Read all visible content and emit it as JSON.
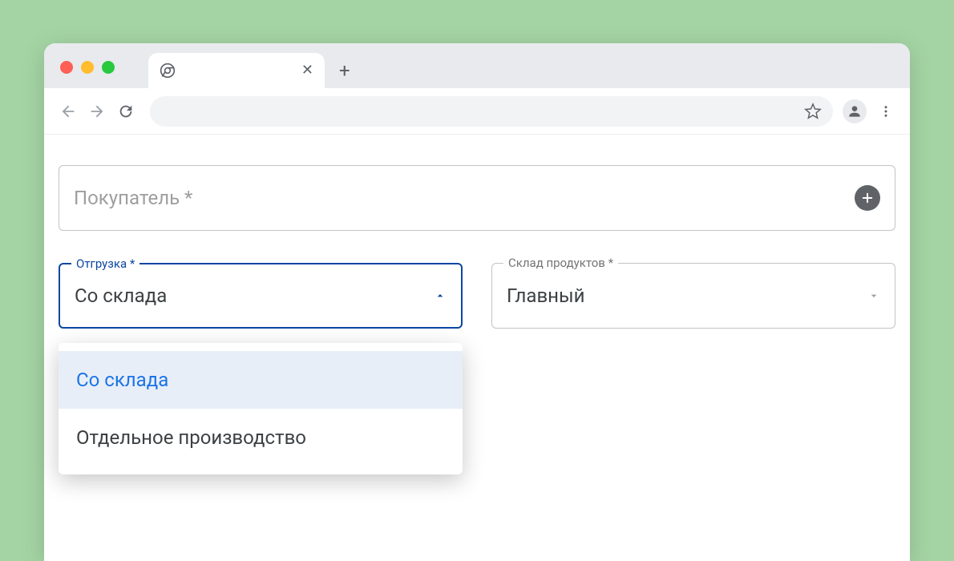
{
  "form": {
    "buyer": {
      "label": "Покупатель *"
    },
    "shipment": {
      "label": "Отгрузка *",
      "value": "Со склада",
      "options": [
        "Со склада",
        "Отдельное производство"
      ]
    },
    "warehouse": {
      "label": "Склад продуктов *",
      "value": "Главный"
    }
  }
}
